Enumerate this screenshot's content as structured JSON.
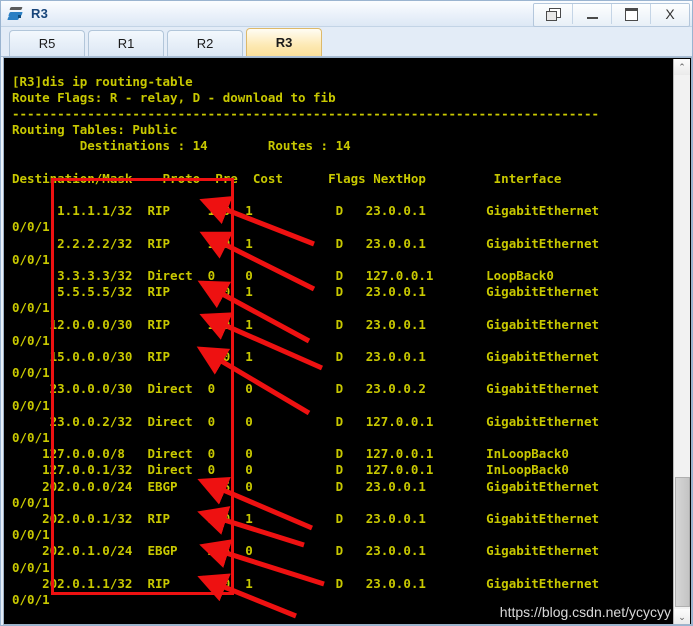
{
  "window": {
    "title": "R3",
    "icon": "router-icon",
    "controls": [
      {
        "name": "restore-button",
        "glyph": "restore-icon",
        "label": "Restore"
      },
      {
        "name": "minimize-button",
        "glyph": "minimize-icon",
        "label": "Minimize"
      },
      {
        "name": "maximize-button",
        "glyph": "maximize-icon",
        "label": "Maximize"
      },
      {
        "name": "close-button",
        "glyph": "close-icon",
        "label": "X"
      }
    ]
  },
  "tabs": [
    {
      "label": "R5",
      "active": false
    },
    {
      "label": "R1",
      "active": false
    },
    {
      "label": "R2",
      "active": false
    },
    {
      "label": "R3",
      "active": true
    }
  ],
  "terminal": {
    "foreground_color": "#c8c800",
    "background_color": "#000000",
    "prompt_line": "[R3]dis ip routing-table",
    "route_flags_line": "Route Flags: R - relay, D - download to fib",
    "separator_line": "------------------------------------------------------------------------------",
    "routing_tables_line": "Routing Tables: Public",
    "counts_line": "         Destinations : 14        Routes : 14",
    "columns": [
      "Destination/Mask",
      "Proto",
      "Pre",
      "Cost",
      "Flags",
      "NextHop",
      "Interface"
    ],
    "header_line": "Destination/Mask    Proto  Pre  Cost      Flags NextHop         Interface",
    "wrap_continuation": "0/0/1",
    "routes": [
      {
        "destination": "1.1.1.1/32",
        "proto": "RIP",
        "pre": "100",
        "cost": "1",
        "flags": "D",
        "nexthop": "23.0.0.1",
        "interface": "GigabitEthernet",
        "interface_wrap": "0/0/1",
        "gap_before": true
      },
      {
        "destination": "2.2.2.2/32",
        "proto": "RIP",
        "pre": "100",
        "cost": "1",
        "flags": "D",
        "nexthop": "23.0.0.1",
        "interface": "GigabitEthernet",
        "interface_wrap": "0/0/1",
        "gap_before": false
      },
      {
        "destination": "3.3.3.3/32",
        "proto": "Direct",
        "pre": "0",
        "cost": "0",
        "flags": "D",
        "nexthop": "127.0.0.1",
        "interface": "LoopBack0",
        "interface_wrap": "",
        "gap_before": false
      },
      {
        "destination": "5.5.5.5/32",
        "proto": "RIP",
        "pre": "100",
        "cost": "1",
        "flags": "D",
        "nexthop": "23.0.0.1",
        "interface": "GigabitEthernet",
        "interface_wrap": "0/0/1",
        "gap_before": false
      },
      {
        "destination": "12.0.0.0/30",
        "proto": "RIP",
        "pre": "100",
        "cost": "1",
        "flags": "D",
        "nexthop": "23.0.0.1",
        "interface": "GigabitEthernet",
        "interface_wrap": "0/0/1",
        "gap_before": false
      },
      {
        "destination": "15.0.0.0/30",
        "proto": "RIP",
        "pre": "100",
        "cost": "1",
        "flags": "D",
        "nexthop": "23.0.0.1",
        "interface": "GigabitEthernet",
        "interface_wrap": "0/0/1",
        "gap_before": false
      },
      {
        "destination": "23.0.0.0/30",
        "proto": "Direct",
        "pre": "0",
        "cost": "0",
        "flags": "D",
        "nexthop": "23.0.0.2",
        "interface": "GigabitEthernet",
        "interface_wrap": "0/0/1",
        "gap_before": false
      },
      {
        "destination": "23.0.0.2/32",
        "proto": "Direct",
        "pre": "0",
        "cost": "0",
        "flags": "D",
        "nexthop": "127.0.0.1",
        "interface": "GigabitEthernet",
        "interface_wrap": "0/0/1",
        "gap_before": false
      },
      {
        "destination": "127.0.0.0/8",
        "proto": "Direct",
        "pre": "0",
        "cost": "0",
        "flags": "D",
        "nexthop": "127.0.0.1",
        "interface": "InLoopBack0",
        "interface_wrap": "",
        "gap_before": false
      },
      {
        "destination": "127.0.0.1/32",
        "proto": "Direct",
        "pre": "0",
        "cost": "0",
        "flags": "D",
        "nexthop": "127.0.0.1",
        "interface": "InLoopBack0",
        "interface_wrap": "",
        "gap_before": false
      },
      {
        "destination": "202.0.0.0/24",
        "proto": "EBGP",
        "pre": "255",
        "cost": "0",
        "flags": "D",
        "nexthop": "23.0.0.1",
        "interface": "GigabitEthernet",
        "interface_wrap": "0/0/1",
        "gap_before": false
      },
      {
        "destination": "202.0.0.1/32",
        "proto": "RIP",
        "pre": "100",
        "cost": "1",
        "flags": "D",
        "nexthop": "23.0.0.1",
        "interface": "GigabitEthernet",
        "interface_wrap": "0/0/1",
        "gap_before": false
      },
      {
        "destination": "202.0.1.0/24",
        "proto": "EBGP",
        "pre": "255",
        "cost": "0",
        "flags": "D",
        "nexthop": "23.0.0.1",
        "interface": "GigabitEthernet",
        "interface_wrap": "0/0/1",
        "gap_before": false
      },
      {
        "destination": "202.0.1.1/32",
        "proto": "RIP",
        "pre": "100",
        "cost": "1",
        "flags": "D",
        "nexthop": "23.0.0.1",
        "interface": "GigabitEthernet",
        "interface_wrap": "0/0/1",
        "gap_before": false
      }
    ],
    "body_text": "[R3]dis ip routing-table\nRoute Flags: R - relay, D - download to fib\n------------------------------------------------------------------------------\nRouting Tables: Public\n         Destinations : 14        Routes : 14\n\nDestination/Mask    Proto  Pre  Cost      Flags NextHop         Interface\n\n      1.1.1.1/32  RIP     100  1           D   23.0.0.1        GigabitEthernet\n0/0/1\n      2.2.2.2/32  RIP     100  1           D   23.0.0.1        GigabitEthernet\n0/0/1\n      3.3.3.3/32  Direct  0    0           D   127.0.0.1       LoopBack0\n      5.5.5.5/32  RIP     100  1           D   23.0.0.1        GigabitEthernet\n0/0/1\n     12.0.0.0/30  RIP     100  1           D   23.0.0.1        GigabitEthernet\n0/0/1\n     15.0.0.0/30  RIP     100  1           D   23.0.0.1        GigabitEthernet\n0/0/1\n     23.0.0.0/30  Direct  0    0           D   23.0.0.2        GigabitEthernet\n0/0/1\n     23.0.0.2/32  Direct  0    0           D   127.0.0.1       GigabitEthernet\n0/0/1\n    127.0.0.0/8   Direct  0    0           D   127.0.0.1       InLoopBack0\n    127.0.0.1/32  Direct  0    0           D   127.0.0.1       InLoopBack0\n    202.0.0.0/24  EBGP    255  0           D   23.0.0.1        GigabitEthernet\n0/0/1\n    202.0.0.1/32  RIP     100  1           D   23.0.0.1        GigabitEthernet\n0/0/1\n    202.0.1.0/24  EBGP    255  0           D   23.0.0.1        GigabitEthernet\n0/0/1\n    202.0.1.1/32  RIP     100  1           D   23.0.0.1        GigabitEthernet\n0/0/1"
  },
  "annotations": {
    "color": "#ee1111",
    "highlight_box_label": "proto-column-highlight",
    "arrow_count": 9,
    "arrow_targets": [
      "RIP",
      "RIP",
      "RIP",
      "RIP",
      "RIP",
      "EBGP",
      "RIP",
      "EBGP",
      "RIP"
    ]
  },
  "scrollbar": {
    "up_arrow": "⌃",
    "down_arrow": "⌄"
  },
  "watermark": {
    "text": "https://blog.csdn.net/ycycyy"
  }
}
